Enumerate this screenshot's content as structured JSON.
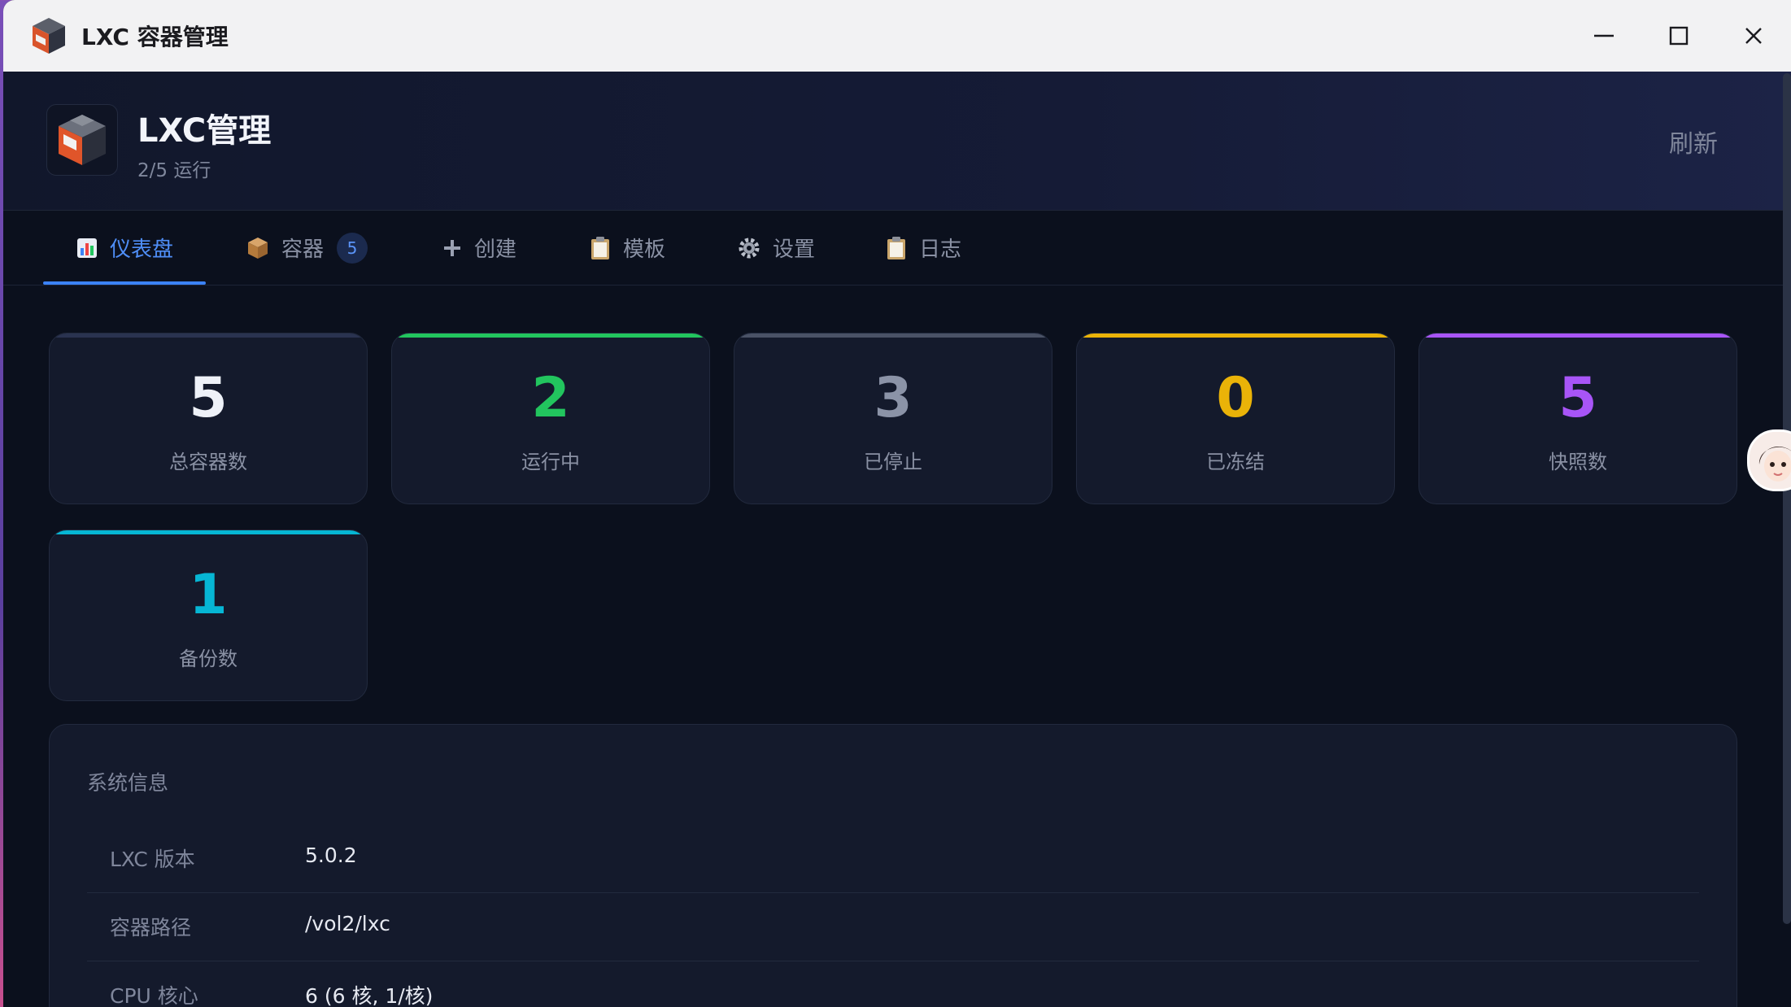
{
  "window": {
    "title": "LXC 容器管理"
  },
  "header": {
    "title": "LXC管理",
    "subtitle": "2/5 运行",
    "refresh_label": "刷新"
  },
  "tabs": [
    {
      "label": "仪表盘",
      "icon": "bar-chart-icon",
      "active": true
    },
    {
      "label": "容器",
      "icon": "package-icon",
      "badge": "5"
    },
    {
      "label": "创建",
      "icon": "plus-icon"
    },
    {
      "label": "模板",
      "icon": "clipboard-icon"
    },
    {
      "label": "设置",
      "icon": "gear-icon"
    },
    {
      "label": "日志",
      "icon": "clipboard-icon"
    }
  ],
  "stats": [
    {
      "value": "5",
      "label": "总容器数",
      "color": "#eef1f8",
      "accent": "#2a3350"
    },
    {
      "value": "2",
      "label": "运行中",
      "color": "#22c55e",
      "accent": "#22c55e"
    },
    {
      "value": "3",
      "label": "已停止",
      "color": "#8b93a7",
      "accent": "#4a5266"
    },
    {
      "value": "0",
      "label": "已冻结",
      "color": "#eab308",
      "accent": "#eab308"
    },
    {
      "value": "5",
      "label": "快照数",
      "color": "#a855f7",
      "accent": "#a855f7"
    },
    {
      "value": "1",
      "label": "备份数",
      "color": "#06b6d4",
      "accent": "#06b6d4"
    }
  ],
  "system_info": {
    "title": "系统信息",
    "rows": [
      {
        "key": "LXC 版本",
        "value": "5.0.2"
      },
      {
        "key": "容器路径",
        "value": "/vol2/lxc"
      },
      {
        "key": "CPU 核心",
        "value": "6 (6 核, 1/核)"
      }
    ]
  }
}
